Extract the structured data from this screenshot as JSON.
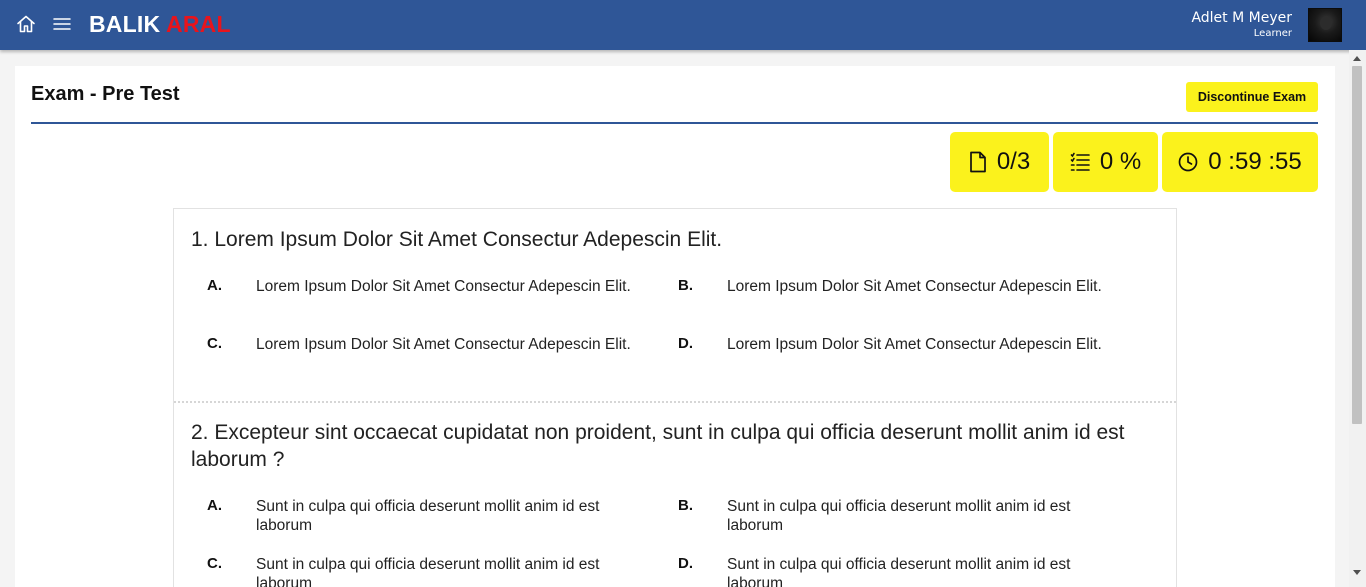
{
  "header": {
    "home_icon": "home-icon",
    "menu_icon": "hamburger-menu-icon",
    "brand_part1": "BALIK",
    "brand_part2": "ARAL",
    "brand_colors": {
      "part1": "#ffffff",
      "part2": "#e8141c"
    },
    "user_name": "Adlet M Meyer",
    "user_role": "Learner",
    "background_color": "#2f5697"
  },
  "exam": {
    "title": "Exam - Pre Test",
    "discontinue_label": "Discontinue Exam",
    "accent_color": "#fbf21c",
    "stats": {
      "answered_icon": "document-icon",
      "answered": "0/3",
      "progress_icon": "checklist-icon",
      "progress": "0 %",
      "timer_icon": "clock-icon",
      "timer": "0 :59 :55"
    }
  },
  "questions": [
    {
      "text": "1. Lorem Ipsum Dolor Sit Amet Consectur Adepescin Elit.",
      "options": [
        {
          "letter": "A.",
          "text": "Lorem Ipsum Dolor Sit Amet Consectur Adepescin Elit."
        },
        {
          "letter": "B.",
          "text": "Lorem Ipsum Dolor Sit Amet Consectur Adepescin Elit."
        },
        {
          "letter": "C.",
          "text": "Lorem Ipsum Dolor Sit Amet Consectur Adepescin Elit."
        },
        {
          "letter": "D.",
          "text": "Lorem Ipsum Dolor Sit Amet Consectur Adepescin Elit."
        }
      ]
    },
    {
      "text": "2. Excepteur sint occaecat cupidatat non proident, sunt in culpa qui officia deserunt mollit anim id est laborum ?",
      "options": [
        {
          "letter": "A.",
          "text": "Sunt in culpa qui officia deserunt mollit anim id est laborum"
        },
        {
          "letter": "B.",
          "text": "Sunt in culpa qui officia deserunt mollit anim id est laborum"
        },
        {
          "letter": "C.",
          "text": "Sunt in culpa qui officia deserunt mollit anim id est laborum"
        },
        {
          "letter": "D.",
          "text": "Sunt in culpa qui officia deserunt mollit anim id est laborum"
        }
      ]
    }
  ]
}
